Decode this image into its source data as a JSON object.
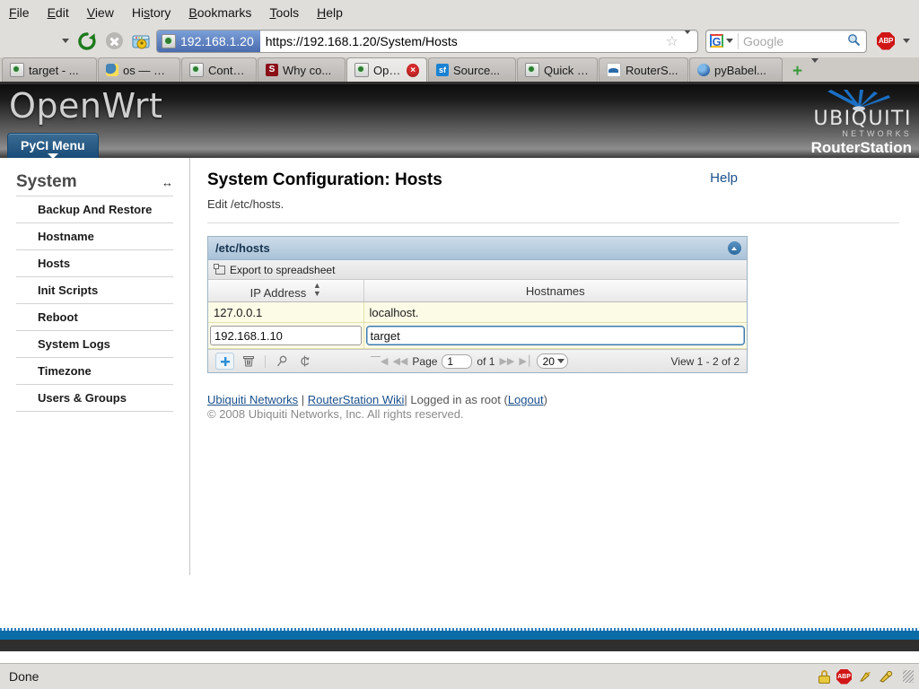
{
  "browser": {
    "menus": [
      "File",
      "Edit",
      "View",
      "History",
      "Bookmarks",
      "Tools",
      "Help"
    ],
    "nav": {
      "back_icon": "back-arrow-icon",
      "forward_icon": "forward-arrow-icon",
      "history_caret": "chevron-down-icon",
      "reload_icon": "reload-icon",
      "stop_icon": "stop-icon",
      "home_icon": "home-icon"
    },
    "url": {
      "identity_label": "192.168.1.20",
      "value": "https://192.168.1.20/System/Hosts",
      "star_icon": "bookmark-star-icon",
      "caret_icon": "chevron-down-icon"
    },
    "search": {
      "engine": "G",
      "placeholder": "Google",
      "magnifier_icon": "search-icon"
    },
    "addon": {
      "label": "ABP",
      "caret": "chevron-down-icon"
    },
    "tabs": [
      {
        "label": "target - ...",
        "favicon": "fav-globe",
        "active": false,
        "closeable": false
      },
      {
        "label": "os — Mi...",
        "favicon": "fav-python",
        "active": false,
        "closeable": false
      },
      {
        "label": "Contest...",
        "favicon": "fav-globe",
        "active": false,
        "closeable": false
      },
      {
        "label": "Why co...",
        "favicon": "fav-s",
        "favicon_text": "S",
        "active": false,
        "closeable": false
      },
      {
        "label": "Ope...",
        "favicon": "fav-globe",
        "active": true,
        "closeable": true
      },
      {
        "label": "Source...",
        "favicon": "fav-sf",
        "favicon_text": "sf",
        "active": false,
        "closeable": false
      },
      {
        "label": "Quick r...",
        "favicon": "fav-globe",
        "active": false,
        "closeable": false
      },
      {
        "label": "RouterS...",
        "favicon": "fav-rs",
        "active": false,
        "closeable": false
      },
      {
        "label": "pyBabel...",
        "favicon": "fav-blue",
        "active": false,
        "closeable": false
      }
    ],
    "new_tab": "+",
    "tab_list_caret": "chevron-down-icon",
    "status": {
      "text": "Done",
      "icons": [
        "lock-icon",
        "abp-icon",
        "plugin-icon",
        "plugin-warning-icon",
        "resize-grip-icon"
      ]
    }
  },
  "site": {
    "logo": "OpenWrt",
    "menu_button": "PyCI Menu",
    "brand": {
      "name": "UBIQUITI",
      "sub": "NETWORKS",
      "product": "RouterStation",
      "burst_icon": "antenna-burst-icon"
    }
  },
  "sidebar": {
    "title": "System",
    "collapse_icon": "collapse-arrows-icon",
    "items": [
      {
        "label": "Backup And Restore"
      },
      {
        "label": "Hostname"
      },
      {
        "label": "Hosts"
      },
      {
        "label": "Init Scripts"
      },
      {
        "label": "Reboot"
      },
      {
        "label": "System Logs"
      },
      {
        "label": "Timezone"
      },
      {
        "label": "Users & Groups"
      }
    ]
  },
  "main": {
    "title": "System Configuration: Hosts",
    "help_label": "Help",
    "subtitle": "Edit /etc/hosts.",
    "panel": {
      "heading": "/etc/hosts",
      "collapse_icon": "collapse-circle-icon",
      "export_label": "Export to spreadsheet",
      "export_icon": "export-spreadsheet-icon",
      "columns": [
        {
          "label": "IP Address",
          "sorted": true,
          "sort_icon": "sort-updown-icon"
        },
        {
          "label": "Hostnames",
          "sorted": false
        }
      ],
      "rows": [
        {
          "ip": "127.0.0.1",
          "hostnames": "localhost.",
          "editing": false
        },
        {
          "ip": "192.168.1.10",
          "hostnames": "target",
          "editing": true,
          "focused_field": "hostnames"
        }
      ],
      "toolbar": {
        "add_icon": "add-plus-icon",
        "delete_icon": "trash-icon",
        "search_icon": "search-icon",
        "refresh_icon": "refresh-icon"
      },
      "pager": {
        "first_icon": "page-first-icon",
        "prev_icon": "page-prev-icon",
        "page_label": "Page",
        "page_value": "1",
        "of_label": "of 1",
        "next_icon": "page-next-icon",
        "last_icon": "page-last-icon",
        "page_size": "20",
        "page_size_caret": "chevron-down-icon",
        "view_label": "View 1 - 2 of 2"
      }
    },
    "footer": {
      "link1": "Ubiquiti Networks",
      "sep1": " | ",
      "link2": "RouterStation Wiki",
      "mid": "| Logged in as root (",
      "logout": "Logout",
      "close": ")",
      "copyright": "© 2008 Ubiquiti Networks, Inc. All rights reserved."
    }
  },
  "colors": {
    "accent_blue": "#0b6ca8",
    "panel_border": "#9cb3c6",
    "row_yellow": "#fcfbe6",
    "link": "#1b4f8a"
  }
}
